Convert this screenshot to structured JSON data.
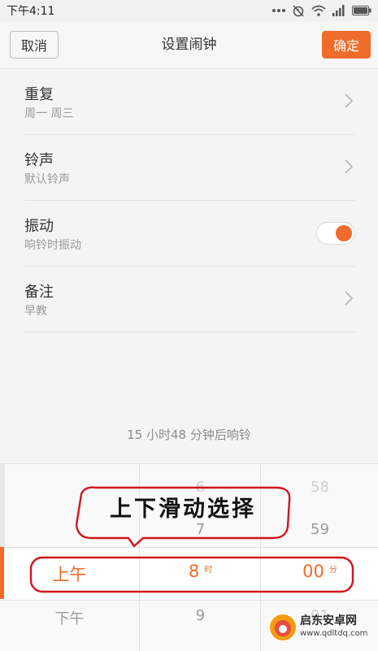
{
  "status_bar": {
    "time": "下午4:11",
    "icons": [
      "more-dots-icon",
      "alarm-off-icon",
      "wifi-icon",
      "signal-icon",
      "battery-icon"
    ]
  },
  "header": {
    "cancel_label": "取消",
    "title": "设置闹钟",
    "ok_label": "确定"
  },
  "settings": {
    "items": [
      {
        "title": "重复",
        "subtitle": "周一 周三",
        "control": "chevron-right-icon"
      },
      {
        "title": "铃声",
        "subtitle": "默认铃声",
        "control": "chevron-right-icon"
      },
      {
        "title": "振动",
        "subtitle": "响铃时振动",
        "control": "toggle",
        "toggle_on": true
      },
      {
        "title": "备注",
        "subtitle": "早教",
        "control": "chevron-right-icon"
      }
    ]
  },
  "countdown_text": "15 小时48 分钟后响铃",
  "picker": {
    "ampm": {
      "selected": "上午",
      "next": "下午"
    },
    "hour": {
      "prev2": "6",
      "prev1": "7",
      "selected": "8",
      "unit": "时",
      "next1": "9"
    },
    "minute": {
      "prev2": "58",
      "prev1": "59",
      "selected": "00",
      "unit": "分",
      "next1": "01"
    }
  },
  "annotation": {
    "text": "上下滑动选择"
  },
  "watermark": {
    "title": "启东安卓网",
    "url": "www.qdltdq.com"
  },
  "colors": {
    "accent": "#ef6c2a",
    "annotation_stroke": "#d2141e"
  }
}
